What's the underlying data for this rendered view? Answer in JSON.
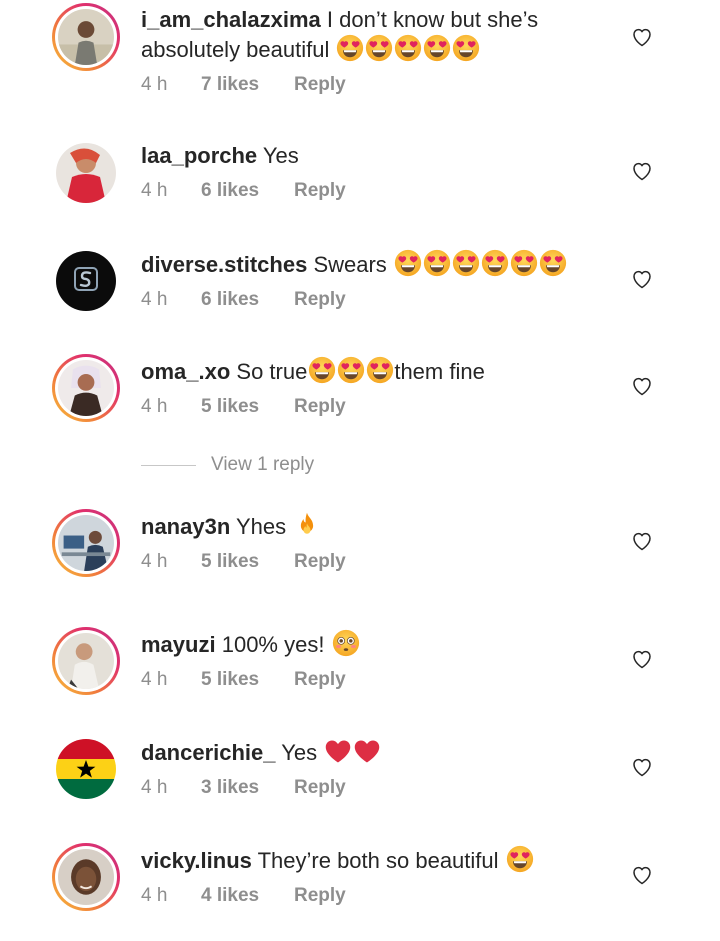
{
  "comments": [
    {
      "username": "i_am_chalazxima",
      "text": "I don’t know but she’s absolutely beautiful",
      "emojis": [
        "heart-eyes-emoji",
        "heart-eyes-emoji",
        "heart-eyes-emoji",
        "heart-eyes-emoji",
        "heart-eyes-emoji"
      ],
      "time": "4 h",
      "likes": "7 likes",
      "reply": "Reply"
    },
    {
      "username": "laa_porche",
      "text": "Yes",
      "emojis": [],
      "time": "4 h",
      "likes": "6 likes",
      "reply": "Reply"
    },
    {
      "username": "diverse.stitches",
      "text": "Swears",
      "emojis": [
        "heart-eyes-emoji",
        "heart-eyes-emoji",
        "heart-eyes-emoji",
        "heart-eyes-emoji",
        "heart-eyes-emoji",
        "heart-eyes-emoji"
      ],
      "time": "4 h",
      "likes": "6 likes",
      "reply": "Reply"
    },
    {
      "username": "oma_.xo",
      "text": "So true",
      "text_after": "them fine",
      "emojis": [
        "heart-eyes-emoji",
        "heart-eyes-emoji",
        "heart-eyes-emoji"
      ],
      "time": "4 h",
      "likes": "5 likes",
      "reply": "Reply",
      "view_replies": "View 1 reply"
    },
    {
      "username": "nanay3n",
      "text": "Yhes",
      "emojis": [
        "fire-emoji"
      ],
      "time": "4 h",
      "likes": "5 likes",
      "reply": "Reply"
    },
    {
      "username": "mayuzi",
      "text": "100% yes!",
      "emojis": [
        "flushed-face-emoji"
      ],
      "time": "4 h",
      "likes": "5 likes",
      "reply": "Reply"
    },
    {
      "username": "dancerichie_",
      "text": "Yes",
      "emojis": [
        "red-heart-emoji",
        "red-heart-emoji"
      ],
      "time": "4 h",
      "likes": "3 likes",
      "reply": "Reply"
    },
    {
      "username": "vicky.linus",
      "text": "They’re both so beautiful",
      "emojis": [
        "heart-eyes-emoji"
      ],
      "time": "4 h",
      "likes": "4 likes",
      "reply": "Reply"
    }
  ],
  "colors": {
    "text": "#262626",
    "muted": "#8e8e8e",
    "ring_start": "#f9c23c",
    "ring_end": "#c13584"
  }
}
